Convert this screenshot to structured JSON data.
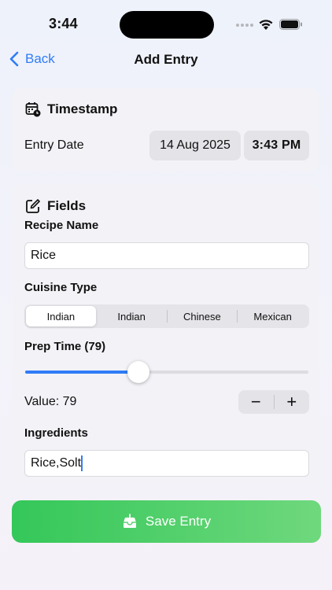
{
  "status_bar": {
    "time": "3:44"
  },
  "nav": {
    "back_label": "Back",
    "title": "Add Entry"
  },
  "timestamp": {
    "header": "Timestamp",
    "entry_date_label": "Entry Date",
    "date_value": "14 Aug 2025",
    "time_value": "3:43 PM"
  },
  "fields": {
    "header": "Fields",
    "recipe_name_label": "Recipe Name",
    "recipe_name_value": "Rice",
    "cuisine_type_label": "Cuisine Type",
    "cuisine_options": [
      "Indian",
      "Indian",
      "Chinese",
      "Mexican"
    ],
    "cuisine_selected_index": 0,
    "prep_time_label": "Prep Time (79)",
    "prep_time_value": 79,
    "prep_time_fraction": 0.4,
    "value_text": "Value: 79",
    "stepper_minus": "−",
    "stepper_plus": "+",
    "ingredients_label": "Ingredients",
    "ingredients_value": "Rice,Solt"
  },
  "save_button": {
    "label": "Save Entry"
  },
  "colors": {
    "accent": "#2f7cf6",
    "save_green": "#34c759"
  },
  "icons": [
    "chevron-left-icon",
    "calendar-clock-icon",
    "edit-square-icon",
    "tray-download-icon",
    "wifi-icon",
    "battery-icon"
  ]
}
